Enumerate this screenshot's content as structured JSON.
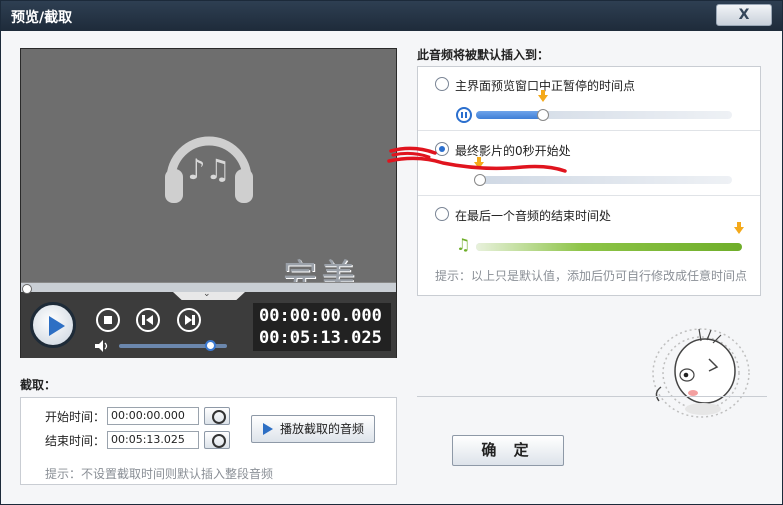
{
  "window": {
    "title": "预览/截取",
    "close_label": "X"
  },
  "player": {
    "watermark": "完美下载",
    "time_current": "00:00:00.000",
    "time_total": "00:05:13.025",
    "seek_progress": 0.0,
    "volume_level": 0.85
  },
  "insert": {
    "title": "此音频将被默认插入到：",
    "options": [
      {
        "label": "主界面预览窗口中正暂停的时间点",
        "selected": false,
        "position": 0.26
      },
      {
        "label": "最终影片的0秒开始处",
        "selected": true,
        "position": 0.0
      },
      {
        "label": "在最后一个音频的结束时间处",
        "selected": false,
        "position": 1.0
      }
    ],
    "hint": "提示：以上只是默认值，添加后仍可自行修改成任意时间点"
  },
  "crop": {
    "title": "截取：",
    "start_label": "开始时间：",
    "start_value": "00:00:00.000",
    "end_label": "结束时间：",
    "end_value": "00:05:13.025",
    "play_label": "播放截取的音频",
    "hint": "提示：不设置截取时间则默认插入整段音频"
  },
  "footer": {
    "confirm_label": "确 定"
  },
  "colors": {
    "accent": "#2b6fce",
    "green": "#6fae2a",
    "marker": "#f4a91a",
    "titlebar": "#1e2b3a"
  }
}
